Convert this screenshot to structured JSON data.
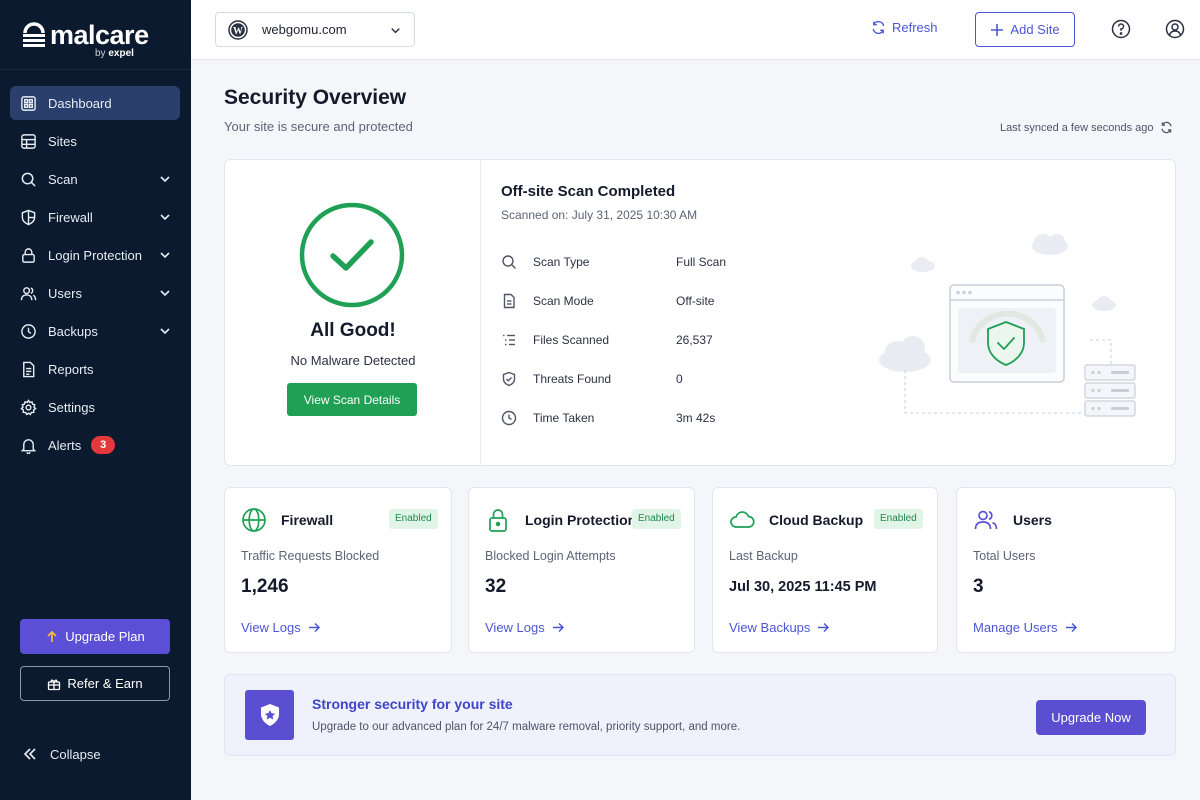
{
  "brand": {
    "name": "malcare",
    "by": "by",
    "company": "expel"
  },
  "sidebar": {
    "items": [
      {
        "label": "Dashboard"
      },
      {
        "label": "Sites"
      },
      {
        "label": "Scan"
      },
      {
        "label": "Firewall"
      },
      {
        "label": "Login Protection"
      },
      {
        "label": "Users"
      },
      {
        "label": "Backups"
      },
      {
        "label": "Reports"
      },
      {
        "label": "Settings"
      },
      {
        "label": "Alerts",
        "badge": "3"
      }
    ],
    "upgrade_label": "Upgrade Plan",
    "refer_label": "Refer & Earn",
    "collapse_label": "Collapse"
  },
  "topbar": {
    "site": "webgomu.com",
    "refresh_label": "Refresh",
    "add_site_label": "Add Site"
  },
  "header": {
    "title": "Security Overview",
    "subtitle": "Your site is secure and protected",
    "synced": "Last synced a few seconds ago"
  },
  "overview": {
    "status_title": "All Good!",
    "status_sub": "No Malware Detected",
    "button": "View Scan Details",
    "scan_title": "Off-site Scan Completed",
    "scan_date": "Scanned on: July 31, 2025 10:30 AM",
    "rows": [
      {
        "icon": "search-icon",
        "label": "Scan Type",
        "value": "Full Scan"
      },
      {
        "icon": "document-icon",
        "label": "Scan Mode",
        "value": "Off-site"
      },
      {
        "icon": "list-icon",
        "label": "Files Scanned",
        "value": "26,537"
      },
      {
        "icon": "shield-check-icon",
        "label": "Threats Found",
        "value": "0"
      },
      {
        "icon": "clock-icon",
        "label": "Time Taken",
        "value": "3m 42s"
      }
    ]
  },
  "stats": [
    {
      "title": "Firewall",
      "badge": "Enabled",
      "label": "Traffic Requests Blocked",
      "value": "1,246",
      "link": "View Logs"
    },
    {
      "title": "Login Protection",
      "badge": "Enabled",
      "label": "Blocked Login Attempts",
      "value": "32",
      "link": "View Logs"
    },
    {
      "title": "Cloud Backup",
      "badge": "Enabled",
      "label": "Last Backup",
      "value": "Jul 30, 2025 11:45 PM",
      "link": "View Backups"
    },
    {
      "title": "Users",
      "label": "Total Users",
      "value": "3",
      "link": "Manage Users"
    }
  ],
  "banner": {
    "title": "Stronger security for your site",
    "text": "Upgrade to our advanced plan for 24/7 malware removal, priority support, and more.",
    "button": "Upgrade Now"
  },
  "colors": {
    "sidebar_bg": "#0b1a2e",
    "accent": "#5b4fd6",
    "success": "#1fa055",
    "alert": "#e5383b"
  }
}
